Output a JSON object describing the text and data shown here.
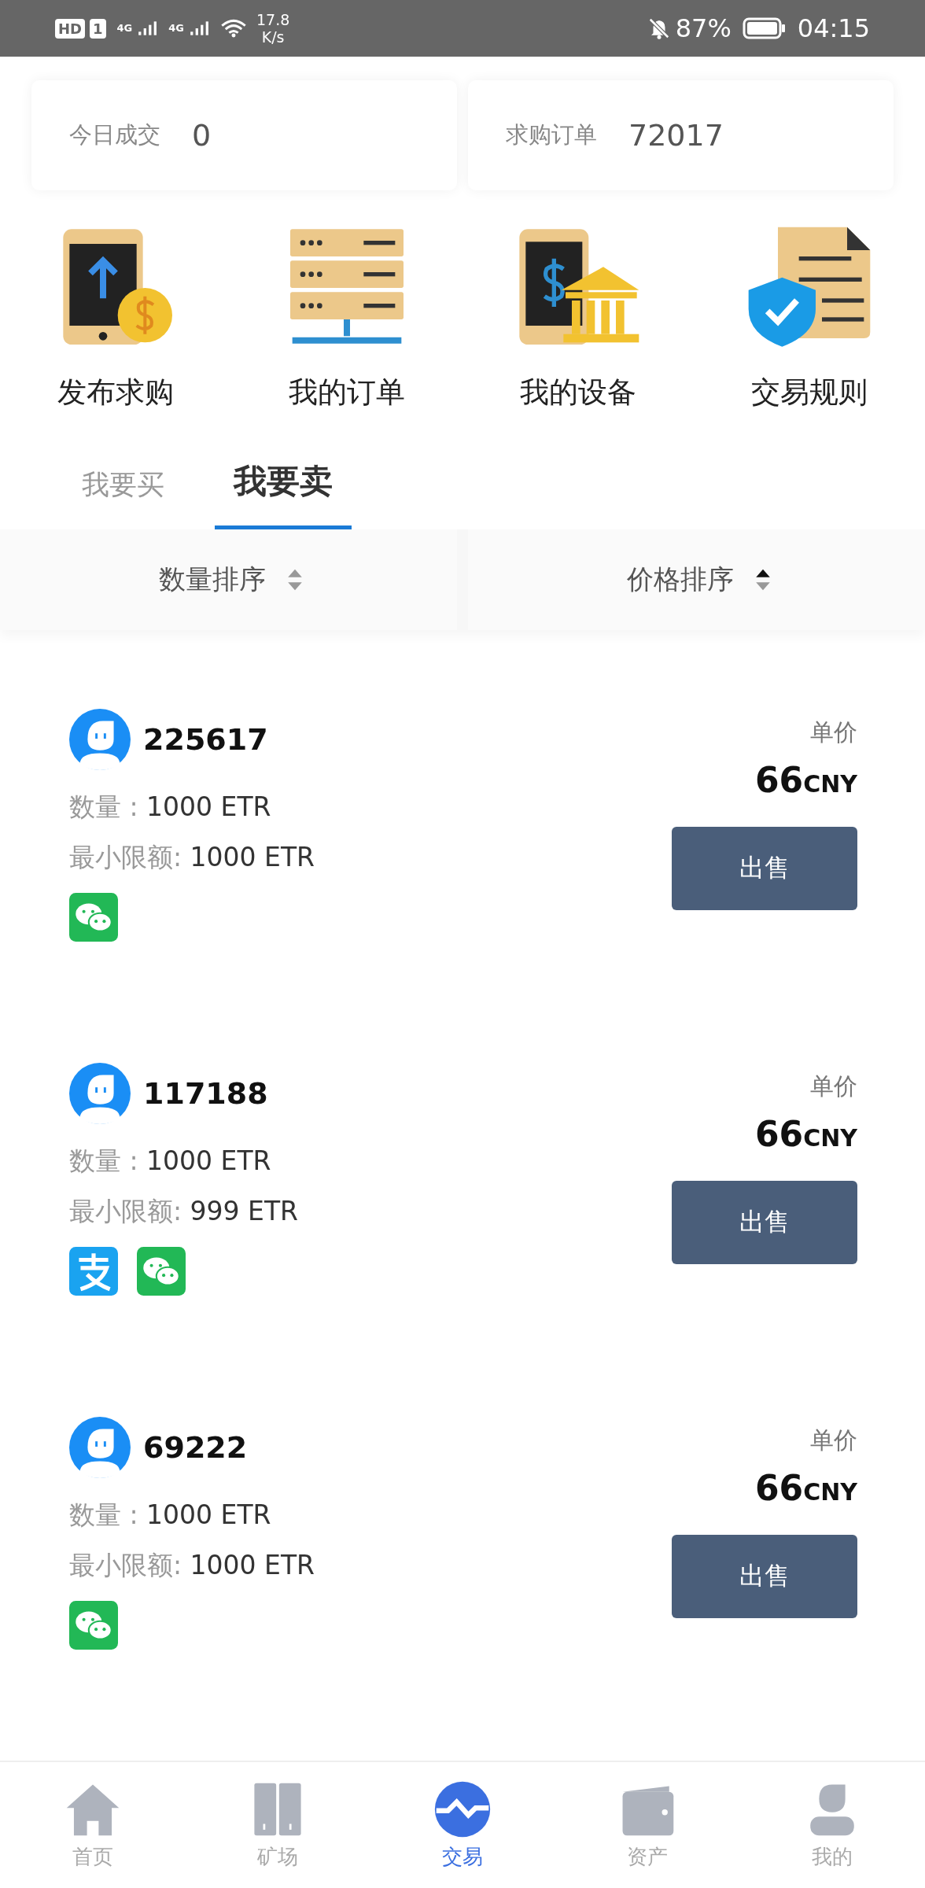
{
  "status_bar": {
    "hd": "HD",
    "sim": "1",
    "net1": "4G",
    "net2": "4G",
    "speed": "17.8",
    "speed_unit": "K/s",
    "battery": "87%",
    "time": "04:15"
  },
  "stats": [
    {
      "label": "今日成交",
      "value": "0"
    },
    {
      "label": "求购订单",
      "value": "72017"
    }
  ],
  "shortcuts": [
    {
      "label": "发布求购"
    },
    {
      "label": "我的订单"
    },
    {
      "label": "我的设备"
    },
    {
      "label": "交易规则"
    }
  ],
  "tabs": [
    {
      "label": "我要买",
      "selected": false
    },
    {
      "label": "我要卖",
      "selected": true
    }
  ],
  "sorts": [
    {
      "label": "数量排序",
      "ascending": false
    },
    {
      "label": "价格排序",
      "ascending": true
    }
  ],
  "listings": [
    {
      "user": "225617",
      "quantity_label": "数量 : ",
      "quantity": "1000 ETR",
      "min_label": "最小限额: ",
      "min": "1000 ETR",
      "payments": [
        {
          "kind": "wechat"
        }
      ],
      "price_label": "单价",
      "price": "66",
      "currency": "CNY",
      "action": "出售"
    },
    {
      "user": "117188",
      "quantity_label": "数量 : ",
      "quantity": "1000 ETR",
      "min_label": "最小限额: ",
      "min": "999 ETR",
      "payments": [
        {
          "kind": "alipay"
        },
        {
          "kind": "wechat"
        }
      ],
      "price_label": "单价",
      "price": "66",
      "currency": "CNY",
      "action": "出售"
    },
    {
      "user": "69222",
      "quantity_label": "数量 : ",
      "quantity": "1000 ETR",
      "min_label": "最小限额: ",
      "min": "1000 ETR",
      "payments": [
        {
          "kind": "wechat"
        }
      ],
      "price_label": "单价",
      "price": "66",
      "currency": "CNY",
      "action": "出售"
    }
  ],
  "nav": [
    {
      "label": "首页",
      "selected": false
    },
    {
      "label": "矿场",
      "selected": false
    },
    {
      "label": "交易",
      "selected": true
    },
    {
      "label": "资产",
      "selected": false
    },
    {
      "label": "我的",
      "selected": false
    }
  ]
}
